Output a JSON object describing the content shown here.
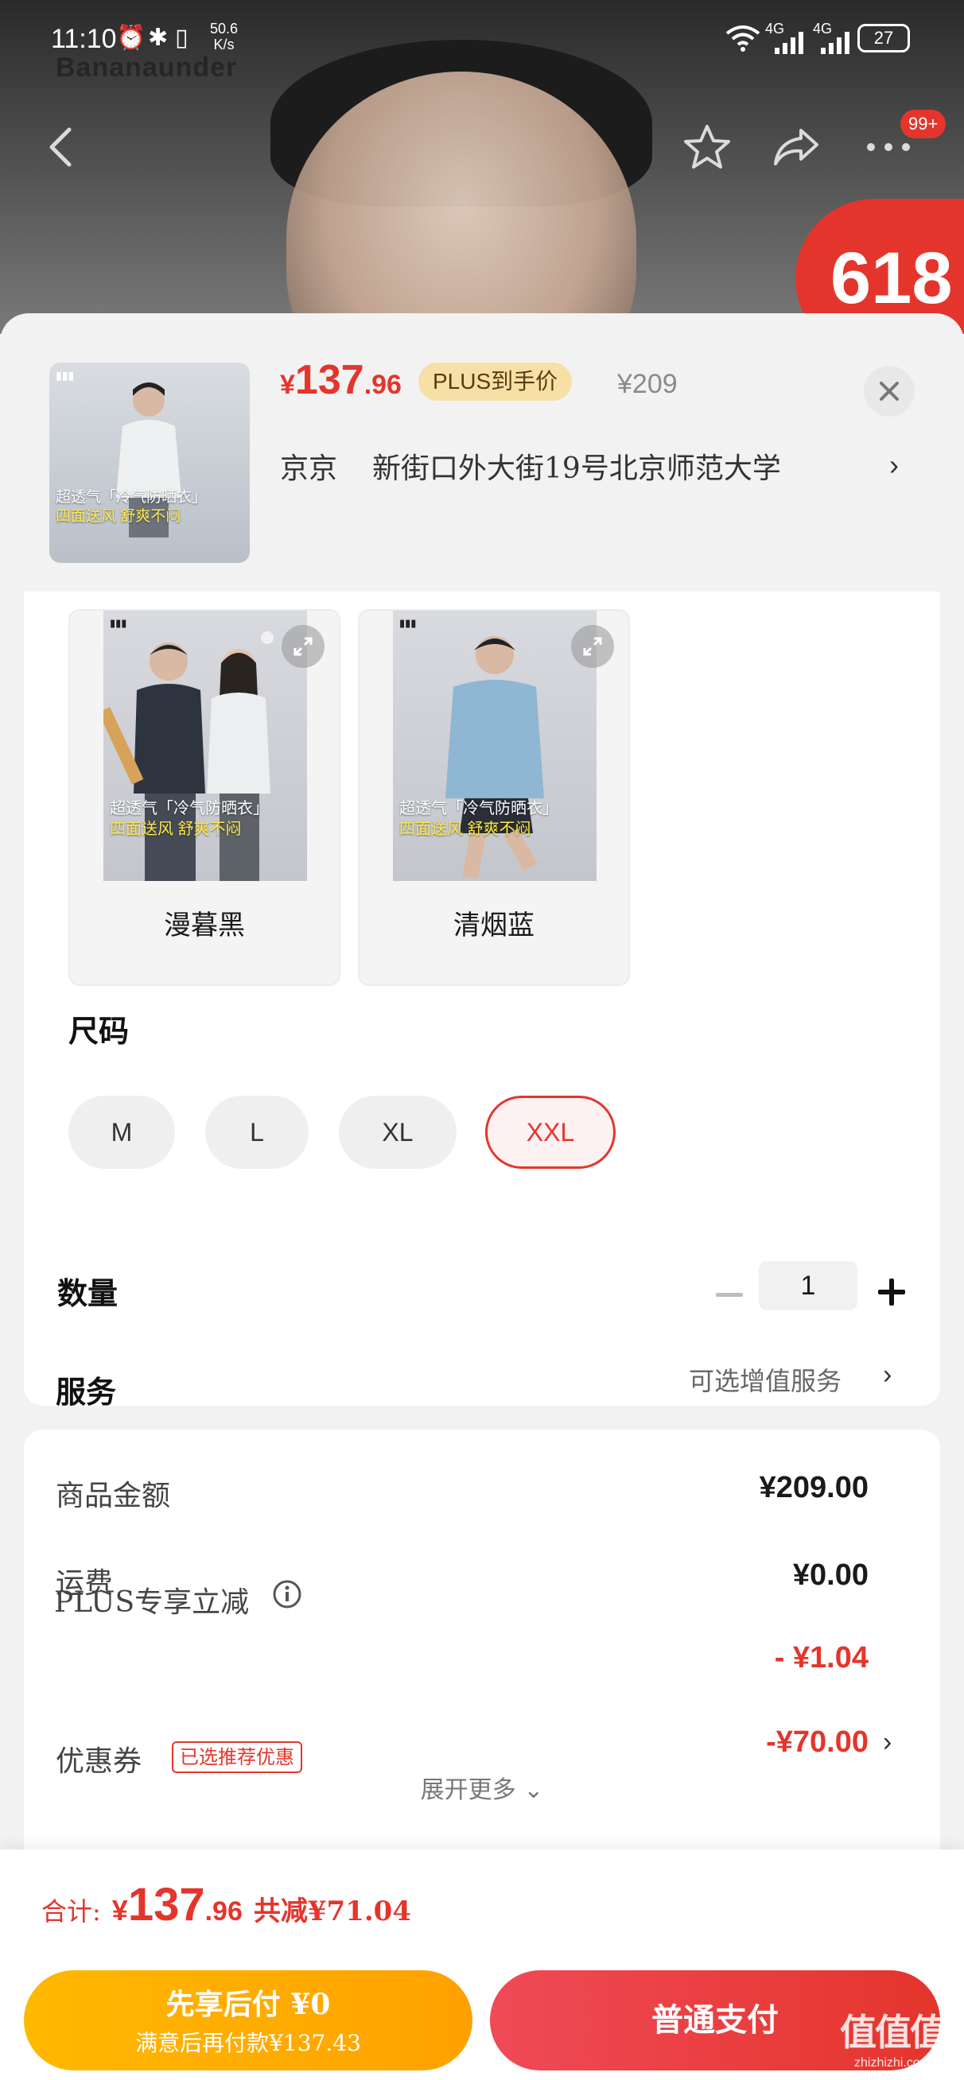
{
  "status_bar": {
    "time": "11:10",
    "net_speed_value": "50.6",
    "net_speed_unit": "K/s",
    "signal_1": "4G",
    "signal_2": "4G",
    "battery": "27"
  },
  "backdrop": {
    "brand_text": "Bananaunder",
    "promo_badge": "618",
    "cart_badge": "99+",
    "icons": [
      "back-icon",
      "star-icon",
      "share-icon",
      "more-icon"
    ]
  },
  "product": {
    "price_symbol": "¥",
    "price_int": "137",
    "price_dec": ".96",
    "plus_tag": "PLUS到手价",
    "original_price": "¥209",
    "address_prefix": "京京",
    "address": "新街口外大街19号北京师范大学",
    "thumb_caption_1": "超透气「冷气防晒衣」",
    "thumb_caption_2": "四面送风 舒爽不闷"
  },
  "colors": [
    {
      "label": "漫暮黑",
      "caption_1": "超透气「冷气防晒衣」",
      "caption_2": "四面送风 舒爽不闷"
    },
    {
      "label": "清烟蓝",
      "caption_1": "超透气「冷气防晒衣」",
      "caption_2": "四面送风 舒爽不闷"
    }
  ],
  "size_section": {
    "title": "尺码",
    "options": [
      "M",
      "L",
      "XL",
      "XXL"
    ],
    "selected": "XXL"
  },
  "quantity": {
    "title": "数量",
    "value": "1"
  },
  "service": {
    "title": "服务",
    "value": "可选增值服务"
  },
  "breakdown": {
    "goods_label": "商品金额",
    "goods_value": "¥209.00",
    "shipping_label": "运费",
    "shipping_value": "¥0.00",
    "plus_label": "PLUS专享立减",
    "plus_value": "- ¥1.04",
    "coupon_label": "优惠券",
    "coupon_tag": "已选推荐优惠",
    "coupon_value": "-¥70.00",
    "expand_more": "展开更多"
  },
  "bottom_bar": {
    "total_label": "合计:",
    "total_symbol": "¥",
    "total_int": "137",
    "total_dec": ".96",
    "total_saving": "共减¥71.04",
    "pay_later_line1": "先享后付 ¥0",
    "pay_later_line2": "满意后再付款¥137.43",
    "pay_now": "普通支付",
    "watermark": "值值值",
    "watermark_url": "zhizhizhi.com"
  },
  "colors_theme": {
    "accent_red": "#e4352c",
    "plus_gold": "#f7e0a6",
    "pay_later_orange": "#ffb800"
  }
}
